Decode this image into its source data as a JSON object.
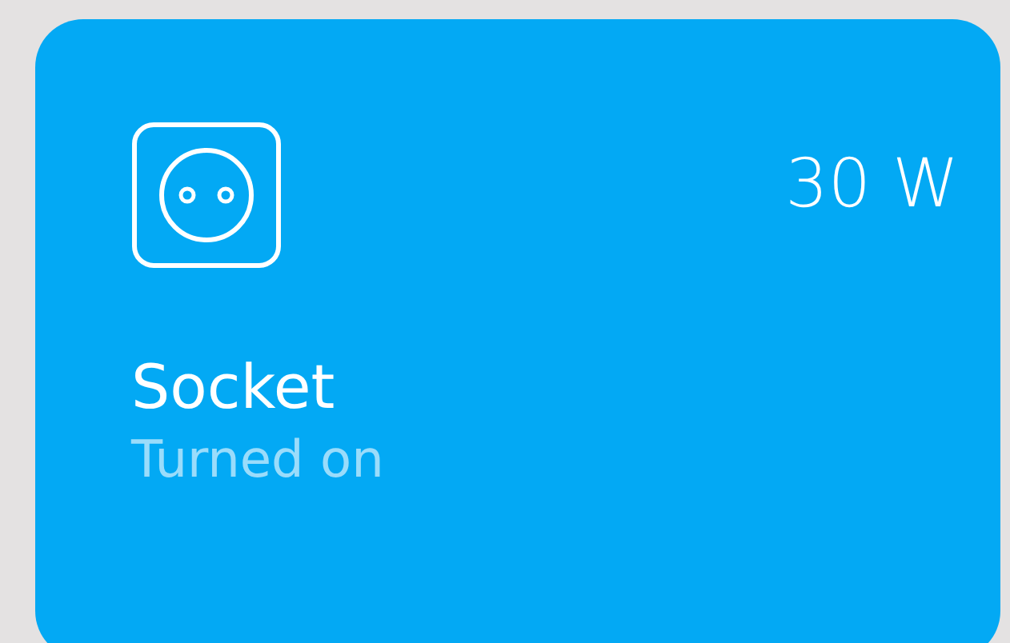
{
  "device": {
    "name": "Socket",
    "status": "Turned on",
    "power": "30 W",
    "on": true
  }
}
